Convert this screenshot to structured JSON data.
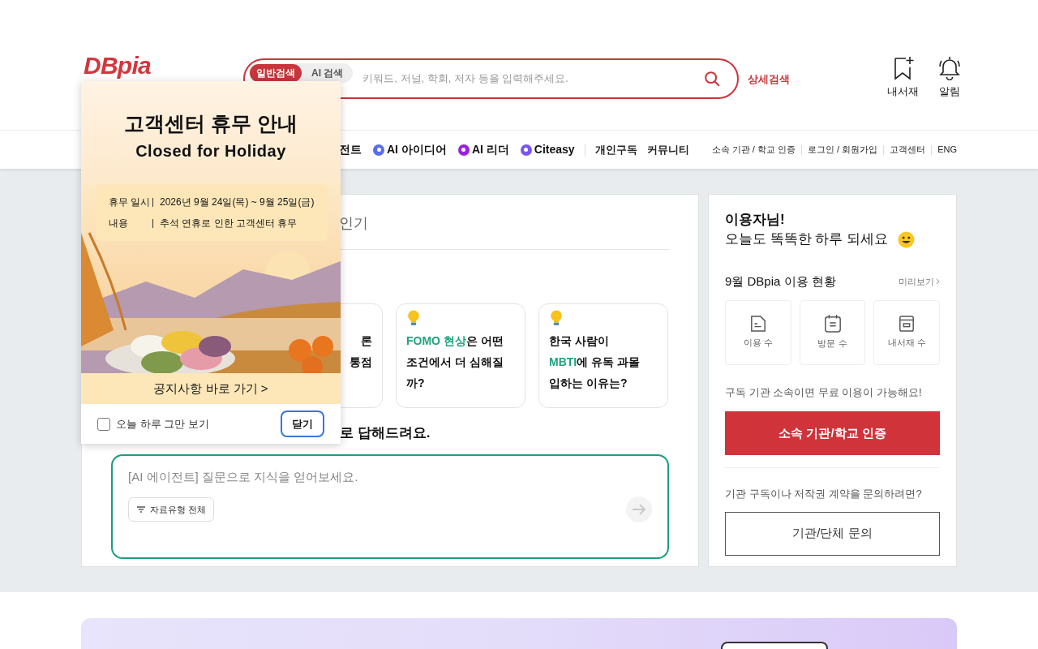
{
  "header": {
    "logo": "DBpia",
    "search": {
      "tabs": [
        {
          "label": "일반검색",
          "selected": true
        },
        {
          "label": "AI 검색",
          "selected": false
        }
      ],
      "placeholder": "키워드, 저널, 학회, 저자 등을 입력해주세요."
    },
    "advanced_search": "상세검색",
    "actions": [
      {
        "label": "내서재",
        "kind": "bookmark"
      },
      {
        "label": "알림",
        "kind": "bell"
      }
    ]
  },
  "nav": {
    "items": [
      {
        "label": "전트",
        "kind": "plain"
      },
      {
        "label": "AI 아이디어",
        "kind": "badge",
        "color": "#5b6cf0"
      },
      {
        "label": "AI 리더",
        "kind": "badge",
        "color": "#9b1fe0"
      },
      {
        "label": "Citeasy",
        "kind": "badge",
        "color": "#7b55f0"
      }
    ],
    "secondary": [
      "개인구독",
      "커뮤니티"
    ],
    "utility": [
      "소속 기관 / 학교 인증",
      "로그인 / 회원가입",
      "고객센터",
      "ENG"
    ]
  },
  "main": {
    "tab": "인기",
    "cards": [
      {
        "bulb": false,
        "lines": [
          [
            {
              "text": "론",
              "highlight": false
            }
          ],
          [
            {
              "text": "통점",
              "highlight": false
            }
          ]
        ]
      },
      {
        "bulb": true,
        "lines": [
          [
            {
              "text": "FOMO 현상",
              "highlight": true
            },
            {
              "text": "은 어떤",
              "highlight": false
            }
          ],
          [
            {
              "text": "조건에서 더 심해질",
              "highlight": false
            }
          ],
          [
            {
              "text": "까?",
              "highlight": false
            }
          ]
        ]
      },
      {
        "bulb": true,
        "lines": [
          [
            {
              "text": "한국 사람이",
              "highlight": false
            }
          ],
          [
            {
              "text": "MBTI",
              "highlight": true
            },
            {
              "text": "에 유독 과몰",
              "highlight": false
            }
          ],
          [
            {
              "text": "입하는 이유는?",
              "highlight": false
            }
          ]
        ]
      }
    ],
    "ask_heading": "로 답해드려요.",
    "agent_input": {
      "placeholder": "[AI 에이전트] 질문으로 지식을 얻어보세요.",
      "filter": "자료유형 전체"
    }
  },
  "sidebar": {
    "greeting": "이용자님!",
    "message": "오늘도 똑똑한 하루 되세요",
    "usage_title": "9월 DBpia 이용 현황",
    "preview_link": "미리보기",
    "stats": [
      {
        "label": "이용 수",
        "kind": "document"
      },
      {
        "label": "방문 수",
        "kind": "calendar"
      },
      {
        "label": "내서재 수",
        "kind": "archive"
      }
    ],
    "promo": "구독 기관 소속이면 무료 이용이 가능해요!",
    "verify_button": "소속 기관/학교 인증",
    "inquiry_prompt": "기관 구독이나 저작권 계약을 문의하려면?",
    "inquiry_button": "기관/단체 문의"
  },
  "popup": {
    "title": "고객센터 휴무 안내",
    "subtitle": "Closed for Holiday",
    "details": [
      {
        "label": "휴무 일시",
        "value": "2026년 9월 24일(목) ~ 9월 25일(금)"
      },
      {
        "label": "내용",
        "value": "추석 연휴로 인한 고객센터 휴무"
      }
    ],
    "link": "공지사항 바로 가기 >",
    "dont_show_today": {
      "label": "오늘 하루 그만 보기",
      "checked": false
    },
    "close_button": "닫기"
  }
}
